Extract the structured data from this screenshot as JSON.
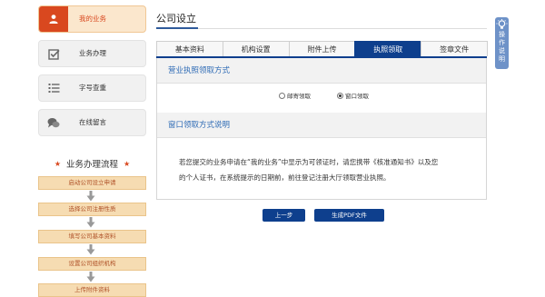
{
  "sidebar": {
    "items": [
      {
        "label": "我的业务",
        "icon": "user-icon"
      },
      {
        "label": "业务办理",
        "icon": "check-box-icon"
      },
      {
        "label": "字号查重",
        "icon": "list-icon"
      },
      {
        "label": "在线留言",
        "icon": "chat-bubble-icon"
      }
    ],
    "flow_title": "业务办理流程",
    "flow_steps": [
      "启动公司设立申请",
      "选择公司注册性质",
      "填写公司基本资料",
      "设置公司组织机构",
      "上传附件资料"
    ]
  },
  "main": {
    "title": "公司设立",
    "tabs": [
      "基本资料",
      "机构设置",
      "附件上传",
      "执照领取",
      "签章文件"
    ],
    "active_tab": "执照领取",
    "section1_title": "营业执照领取方式",
    "radio_options": [
      "邮寄领取",
      "窗口领取"
    ],
    "radio_selected": "窗口领取",
    "section2_title": "窗口领取方式说明",
    "notice_line1": "若您提交的业务申请在“我的业务”中显示为可领证时，请您携带《核准通知书》以及您",
    "notice_line2": "的个人证书，在系统提示的日期前，前往登记注册大厅领取营业执照。",
    "prev_button": "上一步",
    "pdf_button": "生成PDF文件"
  },
  "help_float": {
    "label": "操作说明",
    "icon": "lightbulb-icon"
  },
  "colors": {
    "accent": "#d9481f",
    "primary": "#0e3f8d",
    "link_blue": "#2e6bb5",
    "flow_fill": "#f6dcb2"
  }
}
